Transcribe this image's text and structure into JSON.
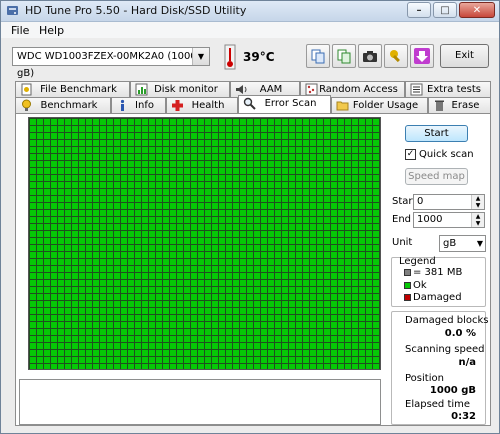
{
  "window": {
    "title": "HD Tune Pro 5.50 - Hard Disk/SSD Utility"
  },
  "window_buttons": [
    "–",
    "□",
    "✕"
  ],
  "menu": {
    "items": [
      "File",
      "Help"
    ]
  },
  "toolbar": {
    "drive": "WDC WD1003FZEX-00MK2A0 (1000 gB)",
    "temperature": "39°C",
    "exit_label": "Exit"
  },
  "tabs": {
    "row1": [
      "File Benchmark",
      "Disk monitor",
      "AAM",
      "Random Access",
      "Extra tests"
    ],
    "row2": [
      "Benchmark",
      "Info",
      "Health",
      "Error Scan",
      "Folder Usage",
      "Erase"
    ],
    "active": "Error Scan"
  },
  "scan": {
    "start_label": "Start",
    "quick_scan_label": "Quick scan",
    "quick_scan_checked": true,
    "speed_map_label": "Speed map",
    "start_field_label": "Start",
    "start_value": "0",
    "end_field_label": "End",
    "end_value": "1000",
    "unit_label": "Unit",
    "unit_value": "gB"
  },
  "legend": {
    "title": "Legend",
    "items": [
      "= 381 MB",
      "Ok",
      "Damaged"
    ],
    "colors": {
      "block": "#7f7f7f",
      "ok": "#06c806",
      "damaged": "#c00000"
    }
  },
  "stats": {
    "damaged_label": "Damaged blocks",
    "damaged_value": "0.0 %",
    "speed_label": "Scanning speed",
    "speed_value": "n/a",
    "position_label": "Position",
    "position_value": "1000 gB",
    "elapsed_label": "Elapsed time",
    "elapsed_value": "0:32"
  }
}
